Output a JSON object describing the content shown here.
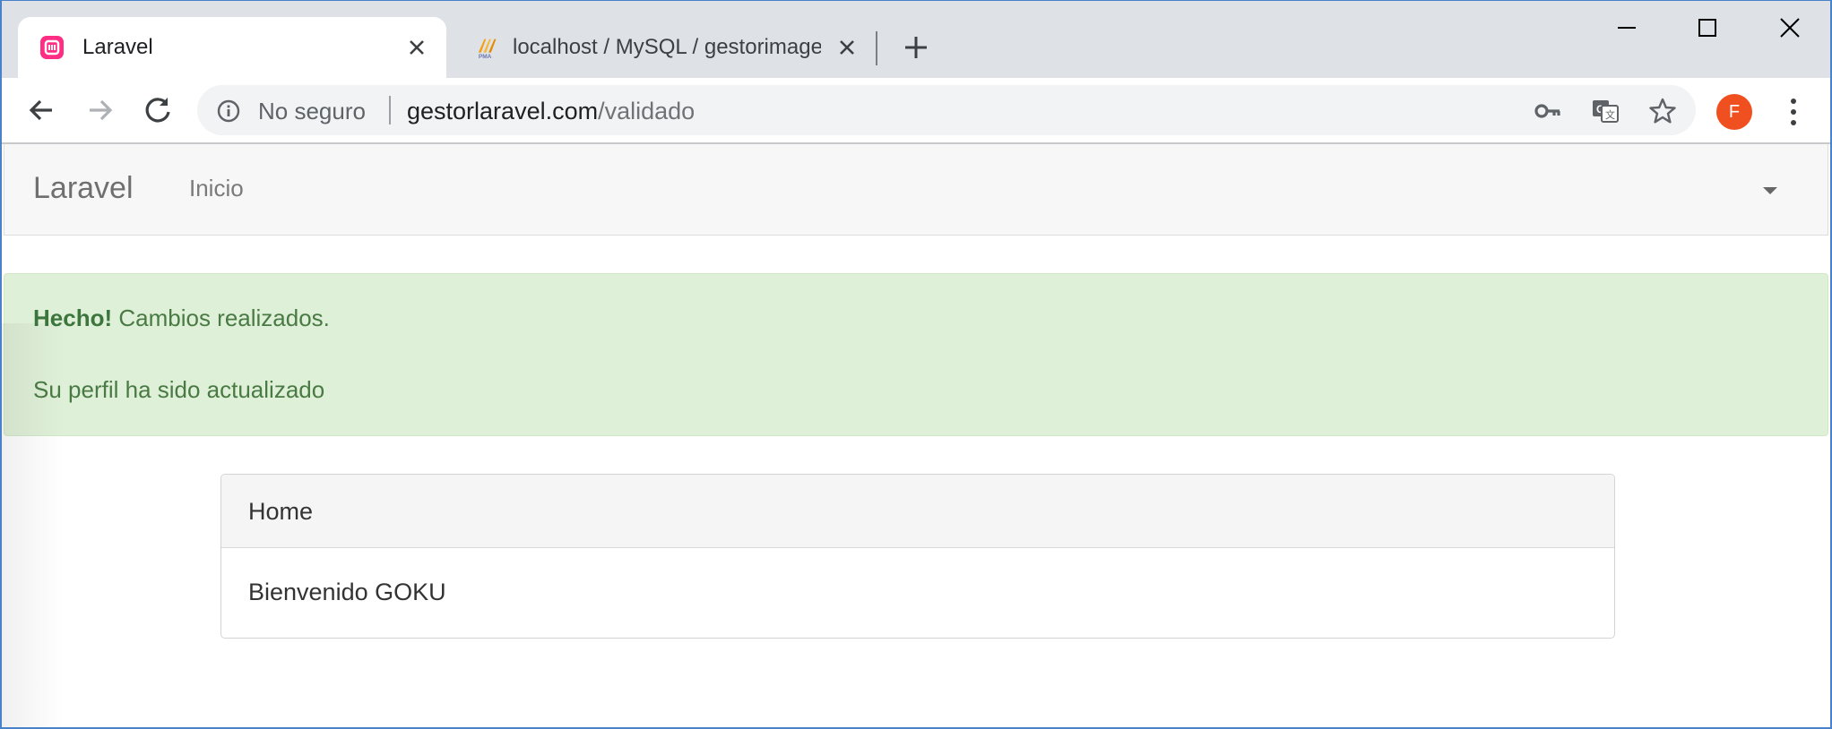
{
  "browser": {
    "tabs": [
      {
        "title": "Laravel",
        "active": true,
        "favicon": "laravel-icon"
      },
      {
        "title": "localhost / MySQL / gestorimagen",
        "active": false,
        "favicon": "phpmyadmin-icon"
      }
    ],
    "omnibox": {
      "security_label": "No seguro",
      "url_host": "gestorlaravel.com",
      "url_path": "/validado"
    },
    "avatar_initial": "F",
    "colors": {
      "tabstrip": "#dee1e6",
      "avatar": "#f0501f"
    }
  },
  "navbar": {
    "brand": "Laravel",
    "links": [
      "Inicio"
    ]
  },
  "alert": {
    "strong": "Hecho!",
    "message": " Cambios realizados.",
    "detail": "Su perfil ha sido actualizado",
    "color": "#dff0d8"
  },
  "panel": {
    "heading": "Home",
    "body": "Bienvenido GOKU"
  }
}
